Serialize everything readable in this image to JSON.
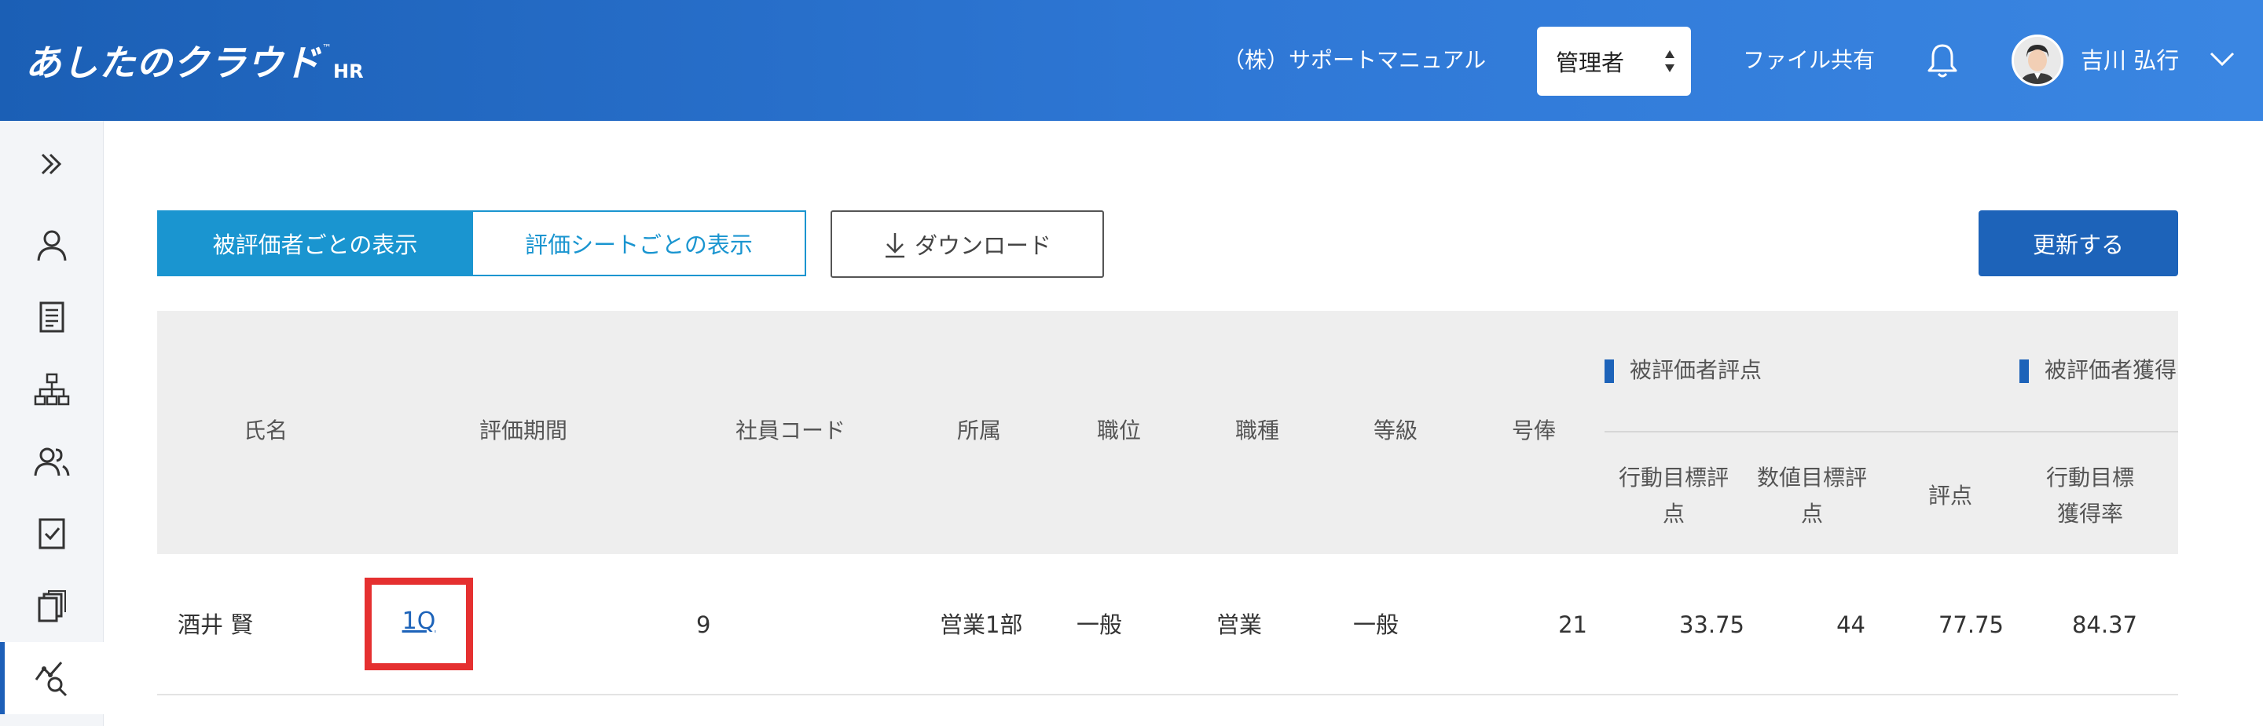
{
  "header": {
    "logo": "あしたのクラウド",
    "logo_tm": "™",
    "logo_sub": "HR",
    "manual_link": "（株）サポートマニュアル",
    "role_select": "管理者",
    "file_share": "ファイル共有",
    "user_name": "吉川 弘行"
  },
  "sidebar": {
    "items": [
      "toggle",
      "person-icon",
      "document-icon",
      "org-chart-icon",
      "users-icon",
      "checklist-icon",
      "copy-icon",
      "analytics-icon"
    ],
    "active": "analytics-icon"
  },
  "controls": {
    "view_by_evaluatee": "被評価者ごとの表示",
    "view_by_sheet": "評価シートごとの表示",
    "download": "ダウンロード",
    "refresh": "更新する"
  },
  "table": {
    "columns": {
      "name": "氏名",
      "period": "評価期間",
      "employee_code": "社員コード",
      "department": "所属",
      "position": "職位",
      "job_type": "職種",
      "grade": "等級",
      "salary_step": "号俸"
    },
    "groups": {
      "evaluatee_score": "被評価者評点",
      "evaluatee_acquired": "被評価者獲得"
    },
    "sub_columns": {
      "action_goal_score_1": "行動目標評",
      "action_goal_score_2": "点",
      "numeric_goal_score_1": "数値目標評",
      "numeric_goal_score_2": "点",
      "score": "評点",
      "action_goal_rate_1": "行動目標",
      "action_goal_rate_2": "獲得率"
    },
    "rows": [
      {
        "name": "酒井 賢",
        "period": "1Q",
        "employee_code": "9",
        "department": "営業1部",
        "position": "一般",
        "job_type": "営業",
        "grade": "一般",
        "salary_step": "21",
        "action_goal_score": "33.75",
        "numeric_goal_score": "44",
        "score": "77.75",
        "action_goal_rate": "84.37"
      }
    ]
  }
}
